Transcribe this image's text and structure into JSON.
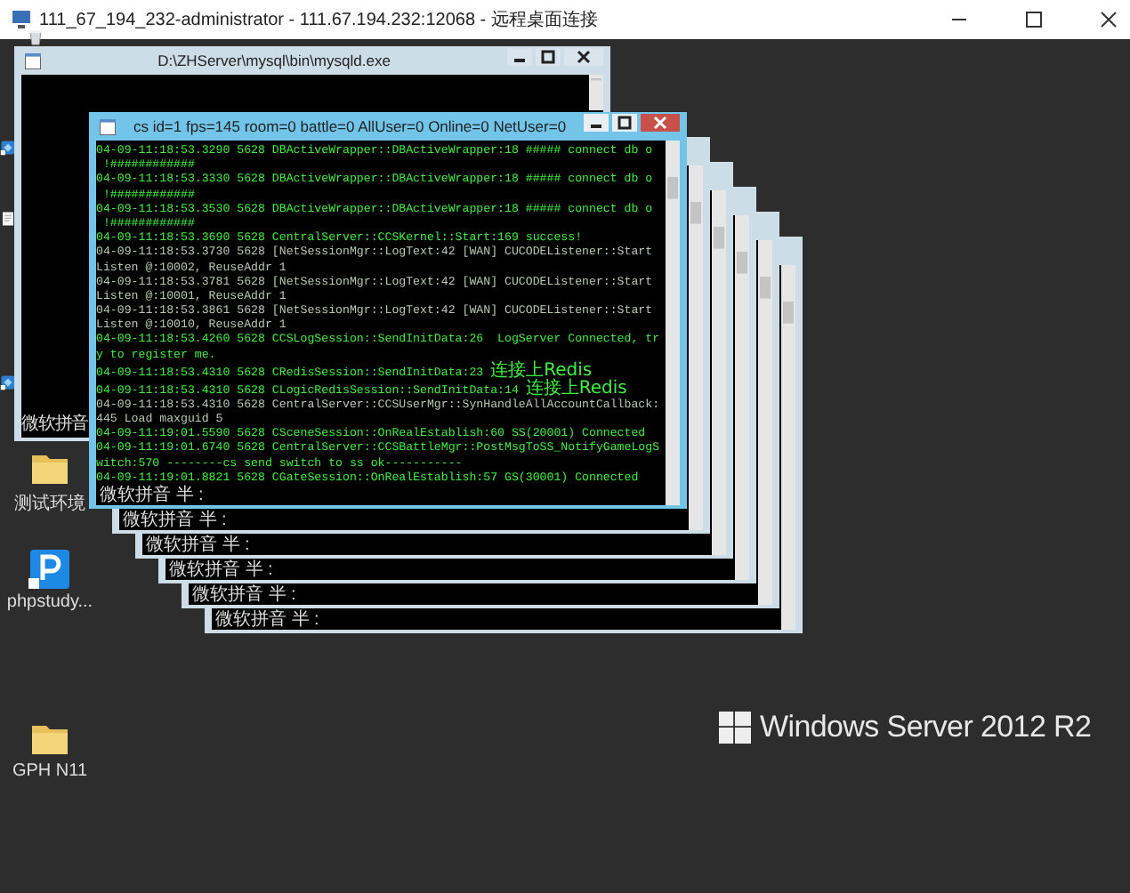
{
  "remote_desktop": {
    "title": "111_67_194_232-administrator - 111.67.194.232:12068 - 远程桌面连接"
  },
  "desktop_icons": [
    {
      "kind": "recycle"
    },
    {
      "kind": "app"
    },
    {
      "kind": "document"
    },
    {
      "kind": "app"
    },
    {
      "kind": "folder",
      "label": "测试环境"
    },
    {
      "kind": "php",
      "label": "phpstudy..."
    },
    {
      "kind": "folder",
      "label": "GPH N11"
    }
  ],
  "background_window": {
    "title": "D:\\ZHServer\\mysql\\bin\\mysqld.exe",
    "ime_status": "微软拼音"
  },
  "stacked_windows": [
    {
      "ime_status": "微软拼音 半 :"
    },
    {
      "ime_status": "微软拼音 半 :"
    },
    {
      "ime_status": "微软拼音 半 :"
    },
    {
      "ime_status": "微软拼音 半 :"
    },
    {
      "ime_status": "微软拼音 半 :"
    }
  ],
  "active_window": {
    "title": "cs id=1 fps=145 room=0 battle=0 AllUser=0 Online=0 NetUser=0",
    "ime_status": "微软拼音 半 :",
    "console_lines": [
      {
        "kind": "bright",
        "text": "04-09-11:18:53.3290 5628 DBActiveWrapper::DBActiveWrapper:18 ##### connect db o"
      },
      {
        "kind": "bright",
        "text": " !############"
      },
      {
        "kind": "bright",
        "text": "04-09-11:18:53.3330 5628 DBActiveWrapper::DBActiveWrapper:18 ##### connect db o"
      },
      {
        "kind": "bright",
        "text": " !############"
      },
      {
        "kind": "bright",
        "text": "04-09-11:18:53.3530 5628 DBActiveWrapper::DBActiveWrapper:18 ##### connect db o"
      },
      {
        "kind": "bright",
        "text": " !############"
      },
      {
        "kind": "bright",
        "text": "04-09-11:18:53.3690 5628 CentralServer::CCSKernel::Start:169 success!"
      },
      {
        "kind": "dim",
        "text": "04-09-11:18:53.3730 5628 [NetSessionMgr::LogText:42 [WAN] CUCODEListener::Start"
      },
      {
        "kind": "dim",
        "text": "Listen @:10002, ReuseAddr 1"
      },
      {
        "kind": "dim",
        "text": "04-09-11:18:53.3781 5628 [NetSessionMgr::LogText:42 [WAN] CUCODEListener::Start"
      },
      {
        "kind": "dim",
        "text": "Listen @:10001, ReuseAddr 1"
      },
      {
        "kind": "dim",
        "text": "04-09-11:18:53.3861 5628 [NetSessionMgr::LogText:42 [WAN] CUCODEListener::Start"
      },
      {
        "kind": "dim",
        "text": "Listen @:10010, ReuseAddr 1"
      },
      {
        "kind": "bright",
        "text": "04-09-11:18:53.4260 5628 CCSLogSession::SendInitData:26  LogServer Connected, tr"
      },
      {
        "kind": "bright",
        "text": "y to register me."
      },
      {
        "kind": "bright",
        "text": "04-09-11:18:53.4310 5628 CRedisSession::SendInitData:23 ",
        "note": "连接上Redis"
      },
      {
        "kind": "bright",
        "text": "04-09-11:18:53.4310 5628 CLogicRedisSession::SendInitData:14 ",
        "note": "连接上Redis"
      },
      {
        "kind": "dim",
        "text": "04-09-11:18:53.4310 5628 CentralServer::CCSUserMgr::SynHandleAllAccountCallback:"
      },
      {
        "kind": "dim",
        "text": "445 Load maxguid 5"
      },
      {
        "kind": "bright",
        "text": "04-09-11:19:01.5590 5628 CSceneSession::OnRealEstablish:60 SS(20001) Connected"
      },
      {
        "kind": "bright",
        "text": "04-09-11:19:01.6740 5628 CentralServer::CCSBattleMgr::PostMsgToSS_NotifyGameLogS"
      },
      {
        "kind": "bright",
        "text": "witch:570 --------cs send switch to ss ok-----------"
      },
      {
        "kind": "bright",
        "text": "04-09-11:19:01.8821 5628 CGateSession::OnRealEstablish:57 GS(30001) Connected"
      }
    ]
  },
  "os_branding": {
    "text": "Windows Server 2012 R2"
  }
}
